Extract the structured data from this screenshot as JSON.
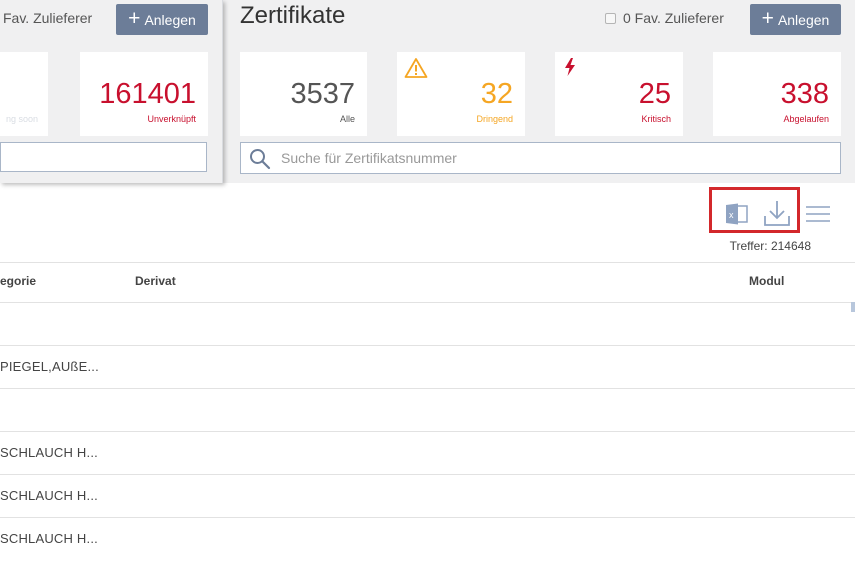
{
  "left_panel": {
    "fav": {
      "count_label": "Fav. Zulieferer"
    },
    "add_button": {
      "label": "Anlegen"
    },
    "card_partial": {
      "label": "ng soon"
    },
    "card_unverknuepft": {
      "value": "161401",
      "label": "Unverknüpft"
    }
  },
  "zertifikate": {
    "title": "Zertifikate",
    "fav": {
      "label": "0 Fav. Zulieferer"
    },
    "add_button": {
      "label": "Anlegen"
    },
    "cards": [
      {
        "value": "3537",
        "label": "Alle",
        "color": "#555555"
      },
      {
        "value": "32",
        "label": "Dringend",
        "color": "#f5a623",
        "icon": "warning-icon"
      },
      {
        "value": "25",
        "label": "Kritisch",
        "color": "#c8102e",
        "icon": "lightning-icon"
      },
      {
        "value": "338",
        "label": "Abgelaufen",
        "color": "#c8102e"
      }
    ],
    "search": {
      "placeholder": "Suche für Zertifikatsnummer"
    }
  },
  "toolbar": {
    "icons": [
      "excel-export-icon",
      "download-icon",
      "menu-icon"
    ],
    "treffer": "Treffer: 214648"
  },
  "table": {
    "headers": [
      "egorie",
      "Derivat",
      "Modul"
    ],
    "rows": [
      {
        "kategorie": ""
      },
      {
        "kategorie": "PIEGEL,AUßE..."
      },
      {
        "kategorie": ""
      },
      {
        "kategorie": "SCHLAUCH H..."
      },
      {
        "kategorie": "SCHLAUCH H..."
      },
      {
        "kategorie": "SCHLAUCH H..."
      }
    ]
  },
  "colors": {
    "accent_button": "#6c7d98",
    "highlight_box": "#d3282b",
    "warning": "#f5a623",
    "critical": "#c8102e"
  }
}
